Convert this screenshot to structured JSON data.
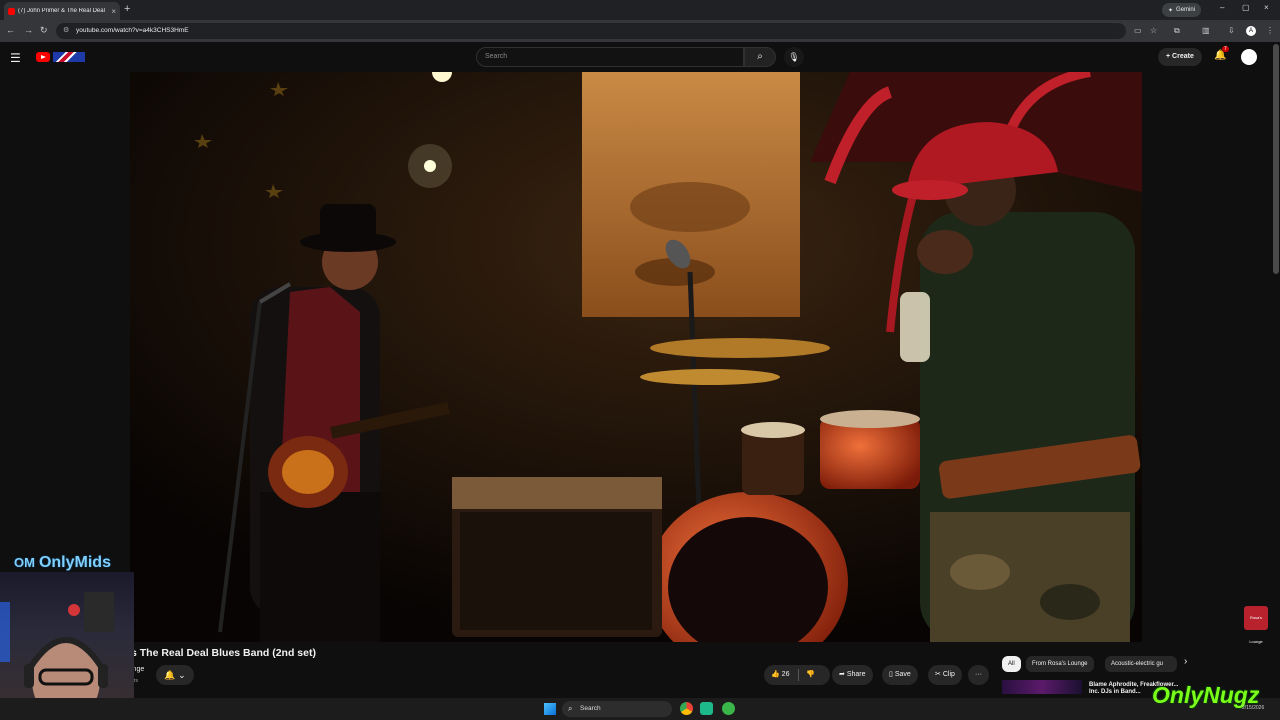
{
  "browser": {
    "tab_title": "(7) John Primer & The Real Deal",
    "tab_close": "×",
    "new_tab": "+",
    "gemini_label": "Gemini",
    "url": "youtube.com/watch?v=a4k3CHS3HmE",
    "nav_back": "←",
    "nav_forward": "→",
    "nav_reload": "↻",
    "win_minimize": "–",
    "win_maximize": "▢",
    "win_close": "×"
  },
  "youtube": {
    "search_placeholder": "Search",
    "create_label": "Create",
    "notifications_count": "7",
    "menu_icon": "☰",
    "search_icon": "⌕",
    "mic_icon": "🎙",
    "bell_icon": "🔔"
  },
  "video": {
    "title_visible": "s The Real Deal Blues Band (2nd set)",
    "channel_visible": "inge",
    "subscribers_visible": "ers",
    "overlay_badge": "Rosa's Lounge",
    "backdrop_sign": "Ros"
  },
  "actions": {
    "like_count": "26",
    "share_label": "Share",
    "save_label": "Save",
    "clip_label": "Clip",
    "more_label": "···",
    "subscribe_bell": "🔔 ⌄"
  },
  "recommendations": {
    "chips": [
      "All",
      "From Rosa's Lounge",
      "Acoustic-electric gu"
    ],
    "next_chip": "›",
    "top_rec_title": "Blame Aphrodite, Freakflower... Inc. DJs in Band..."
  },
  "overlays": {
    "streamer_logo": "OnlyMids",
    "streamer_logo_mark": "OM",
    "watermark": "OnlyNugz"
  },
  "taskbar": {
    "search_label": "Search",
    "date": "2/15/2026"
  },
  "colors": {
    "yt_red": "#ff0000",
    "bg_dark": "#0f0f0f",
    "chip_bg": "#272727",
    "onlymids_blue": "#7fd0ff",
    "onlynugz_green": "#7bff1a"
  }
}
